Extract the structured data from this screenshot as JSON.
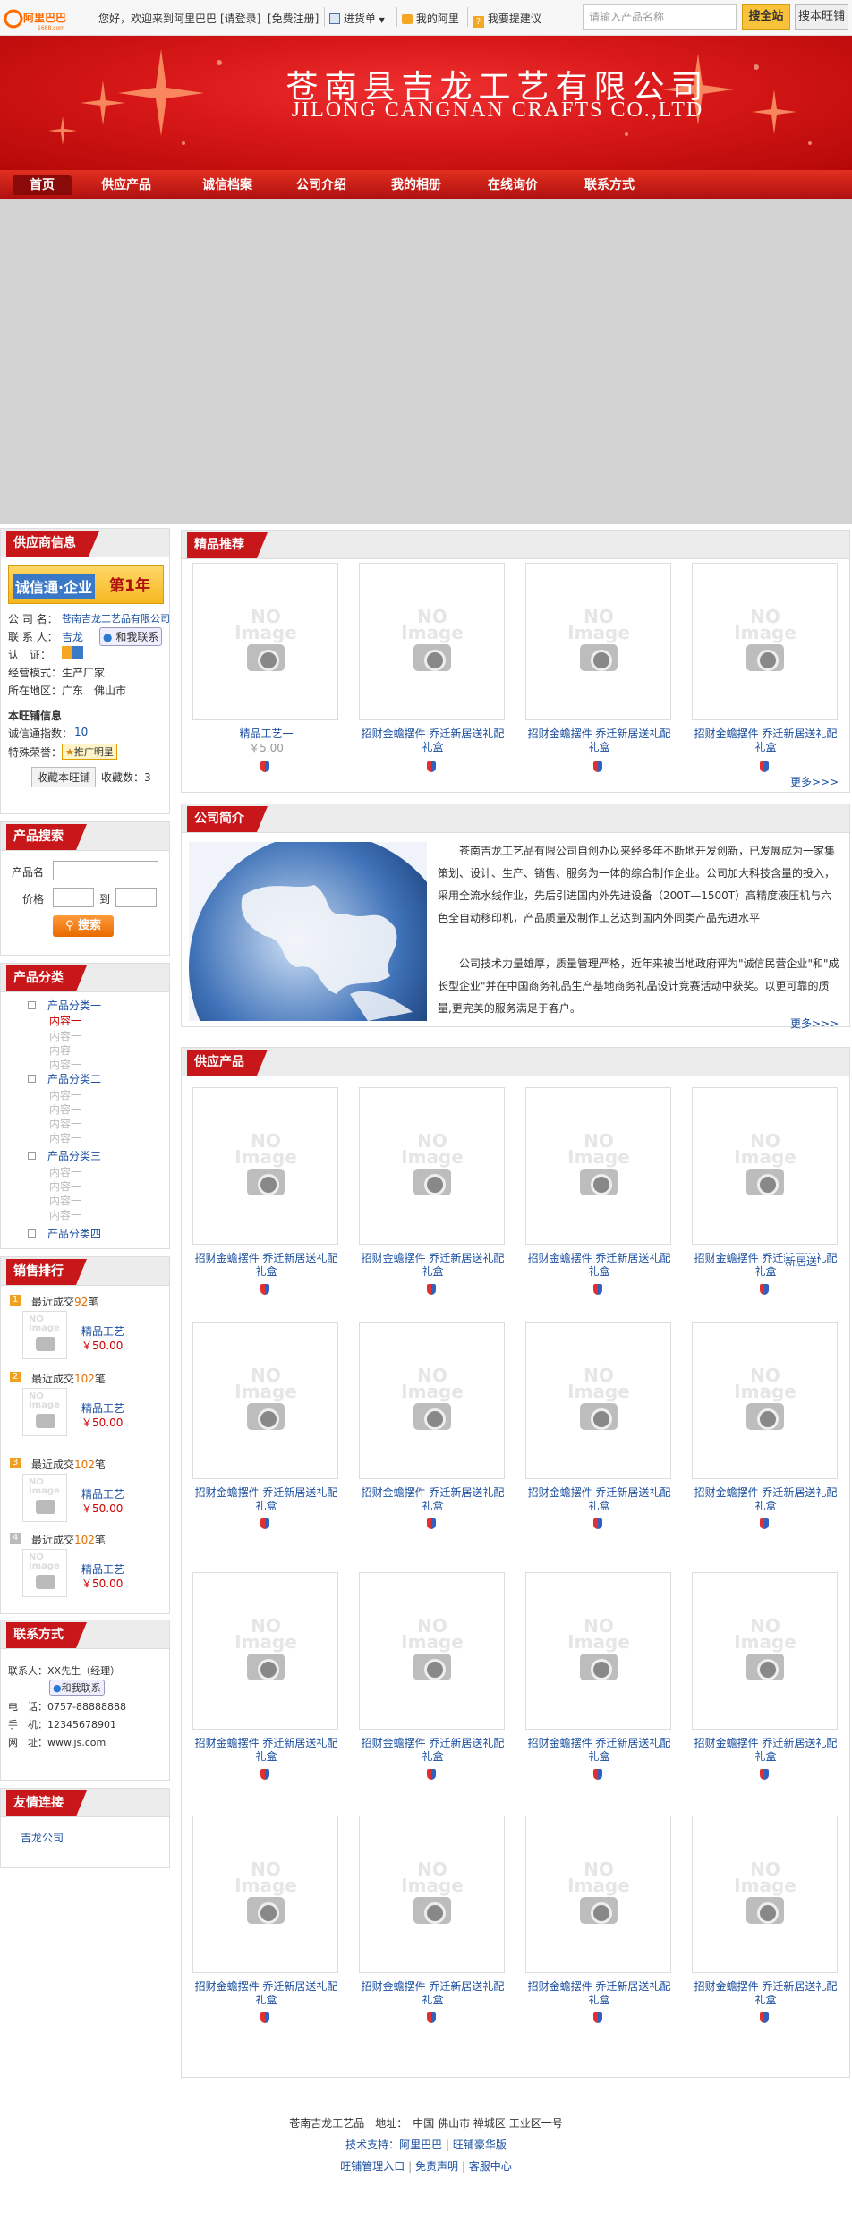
{
  "topbar": {
    "greeting": "您好，欢迎来到阿里巴巴",
    "login": "[请登录]",
    "register": "[免费注册]",
    "purchase": "进货单",
    "my_ali": "我的阿里",
    "suggest": "我要提建议",
    "search_placeholder": "请输入产品名称",
    "search_all": "搜全站",
    "search_shop": "搜本旺铺"
  },
  "banner": {
    "title_cn": "苍南县吉龙工艺有限公司",
    "title_en": "JILONG CANGNAN CRAFTS CO.,LTD"
  },
  "nav": [
    "首页",
    "供应产品",
    "诚信档案",
    "公司介绍",
    "我的相册",
    "在线询价",
    "联系方式"
  ],
  "supplier": {
    "heading": "供应商信息",
    "badge_text": "诚信通·企业",
    "badge_year": "第1年",
    "company_label": "公 司 名：",
    "company": "苍南吉龙工艺品有限公司",
    "contact_label": "联 系 人：",
    "contact": "吉龙",
    "chat": "和我联系",
    "cert_label": "认　证：",
    "mode_label": "经营模式：",
    "mode": "生产厂家",
    "region_label": "所在地区：",
    "region": "广东　佛山市",
    "shop_info": "本旺铺信息",
    "credit_label": "诚信通指数：",
    "credit": "10",
    "service_label": "特殊荣誉：",
    "service": "推广明星",
    "fav_button": "收藏本旺铺",
    "fav_count": "收藏数：3"
  },
  "product_search": {
    "heading": "产品搜索",
    "name_label": "产品名",
    "price_label": "价格",
    "to": "到",
    "button": "搜索"
  },
  "categories": {
    "heading": "产品分类",
    "groups": [
      {
        "name": "产品分类一",
        "items": [
          "内容一",
          "内容一",
          "内容一",
          "内容一"
        ]
      },
      {
        "name": "产品分类二",
        "items": [
          "内容一",
          "内容一",
          "内容一",
          "内容一"
        ]
      },
      {
        "name": "产品分类三",
        "items": [
          "内容一",
          "内容一",
          "内容一",
          "内容一"
        ]
      },
      {
        "name": "产品分类四",
        "items": []
      }
    ]
  },
  "ranking": {
    "heading": "销售排行",
    "items": [
      {
        "rank": "1",
        "sold_prefix": "最近成交",
        "sold": "92",
        "sold_suffix": "笔",
        "name": "精品工艺",
        "price": "￥50.00"
      },
      {
        "rank": "2",
        "sold_prefix": "最近成交",
        "sold": "102",
        "sold_suffix": "笔",
        "name": "精品工艺",
        "price": "￥50.00"
      },
      {
        "rank": "3",
        "sold_prefix": "最近成交",
        "sold": "102",
        "sold_suffix": "笔",
        "name": "精品工艺",
        "price": "￥50.00"
      },
      {
        "rank": "4",
        "sold_prefix": "最近成交",
        "sold": "102",
        "sold_suffix": "笔",
        "name": "精品工艺",
        "price": "￥50.00"
      }
    ]
  },
  "contact": {
    "heading": "联系方式",
    "person": "联系人：XX先生（经理）",
    "chat": "和我联系",
    "phone": "电　话：0757-88888888",
    "mobile": "手　机：12345678901",
    "site": "网　址：www.js.com"
  },
  "links": {
    "heading": "友情连接",
    "items": [
      "吉龙公司"
    ]
  },
  "featured": {
    "heading": "精品推荐",
    "products": [
      {
        "name": "精品工艺一",
        "price": "￥5.00"
      },
      {
        "name": "招财金蟾摆件 乔迁新居送礼配礼盒",
        "price": ""
      },
      {
        "name": "招财金蟾摆件 乔迁新居送礼配礼盒",
        "price": ""
      },
      {
        "name": "招财金蟾摆件 乔迁新居送礼配礼盒",
        "price": ""
      }
    ],
    "more": "更多>>>"
  },
  "intro": {
    "heading": "公司简介",
    "p1": "苍南吉龙工艺品有限公司自创办以来经多年不断地开发创新，已发展成为一家集策划、设计、生产、销售、服务为一体的综合制作企业。公司加大科技含量的投入，采用全流水线作业，先后引进国内外先进设备（200T—1500T）高精度液压机与六色全自动移印机，产品质量及制作工艺达到国内外同类产品先进水平",
    "p2": "公司技术力量雄厚，质量管理严格，近年来被当地政府评为\"诚信民营企业\"和\"成长型企业\"并在中国商务礼品生产基地商务礼品设计竞赛活动中获奖。以更可靠的质量,更完美的服务满足于客户。",
    "more": "更多>>>"
  },
  "supply": {
    "heading": "供应产品",
    "product_name": "招财金蟾摆件 乔迁新居送礼配礼盒",
    "overlap_text": "新居送",
    "no_image": "NO Image"
  },
  "footer": {
    "line1": "苍南吉龙工艺品　地址：　中国 佛山市 禅城区 工业区一号",
    "tech": "技术支持：阿里巴巴",
    "wangpu": "旺铺豪华版",
    "manage": "旺铺管理入口",
    "disclaimer": "免责声明",
    "service": "客服中心"
  }
}
